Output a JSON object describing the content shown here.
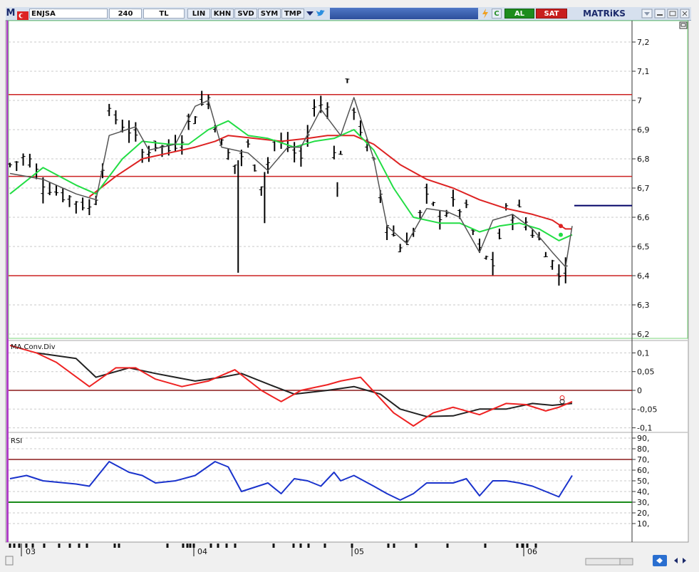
{
  "toolbar": {
    "app_logo": "M",
    "symbol": "ENJSA",
    "interval": "240",
    "currency": "TL",
    "buttons": [
      "LIN",
      "KHN",
      "SVD",
      "SYM",
      "TMP"
    ],
    "buy_label": "AL",
    "sell_label": "SAT",
    "brand": "MATRiKS",
    "refresh_icon": "C"
  },
  "colors": {
    "background": "#ffffff",
    "price_bars": "#000000",
    "ma_short": "#555555",
    "ma_fast": "#22dd44",
    "ma_slow": "#dd2222",
    "level_line": "#cc2222",
    "last_price_line": "#000066",
    "macd": "#222222",
    "macd_signal": "#ee2222",
    "rsi": "#1a33cc",
    "rsi_upper": "#8b1a1a",
    "rsi_lower": "#1a8c1a",
    "buy_green": "#1d8c1d",
    "sell_red": "#c81e1e"
  },
  "chart_data": [
    {
      "type": "ohlc",
      "title": "",
      "x_tick_labels": [
        "03",
        "04",
        "05",
        "06"
      ],
      "ylim": [
        6.2,
        7.25
      ],
      "y_ticks": [
        "7,2",
        "7,1",
        "7",
        "6,9",
        "6,8",
        "6,7",
        "6,6",
        "6,5",
        "6,4",
        "6,3",
        "6,2"
      ],
      "horizontal_levels": [
        7.02,
        6.74,
        6.4
      ],
      "last_price_level": 6.64,
      "bar_count": 85,
      "price_path": [
        [
          0,
          6.78
        ],
        [
          5,
          6.81
        ],
        [
          10,
          6.72
        ],
        [
          15,
          6.68
        ],
        [
          20,
          6.66
        ],
        [
          24,
          6.63
        ],
        [
          27,
          6.7
        ],
        [
          30,
          6.95
        ],
        [
          33,
          6.93
        ],
        [
          36,
          6.9
        ],
        [
          40,
          6.82
        ],
        [
          44,
          6.85
        ],
        [
          48,
          6.83
        ],
        [
          52,
          6.88
        ],
        [
          56,
          6.96
        ],
        [
          60,
          7.01
        ],
        [
          64,
          6.85
        ],
        [
          68,
          6.78
        ],
        [
          72,
          6.84
        ],
        [
          76,
          6.72
        ],
        [
          80,
          6.86
        ],
        [
          84,
          6.84
        ],
        [
          88,
          6.8
        ],
        [
          92,
          6.97
        ],
        [
          96,
          7.0
        ],
        [
          99,
          6.72
        ],
        [
          102,
          7.05
        ],
        [
          106,
          6.9
        ],
        [
          110,
          6.78
        ],
        [
          114,
          6.58
        ],
        [
          118,
          6.5
        ],
        [
          122,
          6.55
        ],
        [
          126,
          6.66
        ],
        [
          130,
          6.61
        ],
        [
          134,
          6.64
        ],
        [
          138,
          6.62
        ],
        [
          142,
          6.48
        ],
        [
          146,
          6.44
        ],
        [
          150,
          6.62
        ],
        [
          154,
          6.62
        ],
        [
          158,
          6.55
        ],
        [
          162,
          6.49
        ],
        [
          166,
          6.4
        ],
        [
          168,
          6.45
        ],
        [
          170,
          6.58
        ]
      ],
      "ma_short_path": [
        [
          0,
          6.75
        ],
        [
          10,
          6.73
        ],
        [
          20,
          6.68
        ],
        [
          26,
          6.66
        ],
        [
          30,
          6.88
        ],
        [
          38,
          6.91
        ],
        [
          42,
          6.83
        ],
        [
          50,
          6.85
        ],
        [
          56,
          6.98
        ],
        [
          60,
          7.0
        ],
        [
          64,
          6.84
        ],
        [
          72,
          6.82
        ],
        [
          78,
          6.76
        ],
        [
          84,
          6.84
        ],
        [
          88,
          6.84
        ],
        [
          94,
          6.97
        ],
        [
          100,
          6.88
        ],
        [
          104,
          7.01
        ],
        [
          110,
          6.8
        ],
        [
          114,
          6.57
        ],
        [
          120,
          6.51
        ],
        [
          126,
          6.63
        ],
        [
          132,
          6.62
        ],
        [
          136,
          6.6
        ],
        [
          142,
          6.48
        ],
        [
          146,
          6.59
        ],
        [
          152,
          6.61
        ],
        [
          158,
          6.56
        ],
        [
          164,
          6.48
        ],
        [
          168,
          6.43
        ],
        [
          170,
          6.57
        ]
      ],
      "ma_fast_path": [
        [
          0,
          6.68
        ],
        [
          10,
          6.77
        ],
        [
          20,
          6.71
        ],
        [
          26,
          6.68
        ],
        [
          34,
          6.8
        ],
        [
          40,
          6.86
        ],
        [
          48,
          6.85
        ],
        [
          54,
          6.85
        ],
        [
          60,
          6.9
        ],
        [
          66,
          6.93
        ],
        [
          72,
          6.88
        ],
        [
          78,
          6.87
        ],
        [
          86,
          6.84
        ],
        [
          92,
          6.86
        ],
        [
          98,
          6.87
        ],
        [
          104,
          6.9
        ],
        [
          110,
          6.83
        ],
        [
          116,
          6.7
        ],
        [
          122,
          6.6
        ],
        [
          130,
          6.58
        ],
        [
          136,
          6.58
        ],
        [
          142,
          6.55
        ],
        [
          148,
          6.57
        ],
        [
          154,
          6.58
        ],
        [
          160,
          6.56
        ],
        [
          166,
          6.52
        ],
        [
          170,
          6.54
        ]
      ],
      "ma_slow_path": [
        [
          24,
          6.67
        ],
        [
          32,
          6.74
        ],
        [
          40,
          6.8
        ],
        [
          48,
          6.82
        ],
        [
          56,
          6.84
        ],
        [
          62,
          6.86
        ],
        [
          66,
          6.88
        ],
        [
          74,
          6.87
        ],
        [
          82,
          6.86
        ],
        [
          90,
          6.87
        ],
        [
          96,
          6.88
        ],
        [
          104,
          6.88
        ],
        [
          110,
          6.85
        ],
        [
          118,
          6.78
        ],
        [
          126,
          6.73
        ],
        [
          134,
          6.7
        ],
        [
          142,
          6.66
        ],
        [
          150,
          6.63
        ],
        [
          158,
          6.61
        ],
        [
          164,
          6.59
        ],
        [
          168,
          6.56
        ],
        [
          170,
          6.56
        ]
      ],
      "end_markers": [
        6.57,
        6.54
      ]
    },
    {
      "type": "line",
      "title": "MA.Conv.Div",
      "ylim": [
        -0.11,
        0.12
      ],
      "y_ticks": [
        "0,1",
        "0,05",
        "0",
        "-0,05",
        "-0,1"
      ],
      "zero_line": 0,
      "series": [
        {
          "name": "",
          "values": [
            [
              8,
              0.1
            ],
            [
              20,
              0.085
            ],
            [
              26,
              0.035
            ],
            [
              36,
              0.06
            ],
            [
              44,
              0.045
            ],
            [
              56,
              0.025
            ],
            [
              64,
              0.035
            ],
            [
              70,
              0.045
            ],
            [
              80,
              0.01
            ],
            [
              86,
              -0.01
            ],
            [
              96,
              0.0
            ],
            [
              104,
              0.01
            ],
            [
              112,
              -0.01
            ],
            [
              118,
              -0.05
            ],
            [
              126,
              -0.07
            ],
            [
              134,
              -0.068
            ],
            [
              142,
              -0.05
            ],
            [
              150,
              -0.05
            ],
            [
              158,
              -0.035
            ],
            [
              164,
              -0.04
            ],
            [
              170,
              -0.035
            ]
          ]
        },
        {
          "name": "",
          "values": [
            [
              0,
              0.12
            ],
            [
              8,
              0.1
            ],
            [
              14,
              0.075
            ],
            [
              24,
              0.01
            ],
            [
              32,
              0.06
            ],
            [
              38,
              0.06
            ],
            [
              44,
              0.03
            ],
            [
              52,
              0.01
            ],
            [
              60,
              0.025
            ],
            [
              68,
              0.055
            ],
            [
              76,
              0.0
            ],
            [
              82,
              -0.03
            ],
            [
              88,
              0.0
            ],
            [
              96,
              0.015
            ],
            [
              100,
              0.025
            ],
            [
              106,
              0.035
            ],
            [
              116,
              -0.06
            ],
            [
              122,
              -0.095
            ],
            [
              128,
              -0.06
            ],
            [
              134,
              -0.045
            ],
            [
              142,
              -0.065
            ],
            [
              150,
              -0.035
            ],
            [
              156,
              -0.038
            ],
            [
              162,
              -0.055
            ],
            [
              166,
              -0.045
            ],
            [
              170,
              -0.03
            ]
          ]
        }
      ],
      "end_markers": [
        -0.02,
        -0.03
      ]
    },
    {
      "type": "line",
      "title": "RSI",
      "ylim": [
        0,
        100
      ],
      "y_ticks": [
        "90,",
        "80,",
        "70,",
        "60,",
        "50,",
        "40,",
        "30,",
        "20,",
        "10,"
      ],
      "upper_level": 70,
      "lower_level": 30,
      "series": [
        {
          "name": "",
          "values": [
            [
              0,
              52
            ],
            [
              5,
              55
            ],
            [
              10,
              50
            ],
            [
              20,
              47
            ],
            [
              24,
              45
            ],
            [
              30,
              68
            ],
            [
              36,
              58
            ],
            [
              40,
              55
            ],
            [
              44,
              48
            ],
            [
              50,
              50
            ],
            [
              56,
              55
            ],
            [
              62,
              68
            ],
            [
              66,
              63
            ],
            [
              70,
              40
            ],
            [
              78,
              48
            ],
            [
              82,
              38
            ],
            [
              86,
              52
            ],
            [
              90,
              50
            ],
            [
              94,
              45
            ],
            [
              98,
              58
            ],
            [
              100,
              50
            ],
            [
              104,
              55
            ],
            [
              110,
              45
            ],
            [
              114,
              38
            ],
            [
              118,
              32
            ],
            [
              122,
              38
            ],
            [
              126,
              48
            ],
            [
              130,
              48
            ],
            [
              134,
              48
            ],
            [
              138,
              52
            ],
            [
              142,
              36
            ],
            [
              146,
              50
            ],
            [
              150,
              50
            ],
            [
              154,
              48
            ],
            [
              158,
              45
            ],
            [
              162,
              40
            ],
            [
              166,
              35
            ],
            [
              170,
              55
            ]
          ]
        }
      ]
    }
  ]
}
